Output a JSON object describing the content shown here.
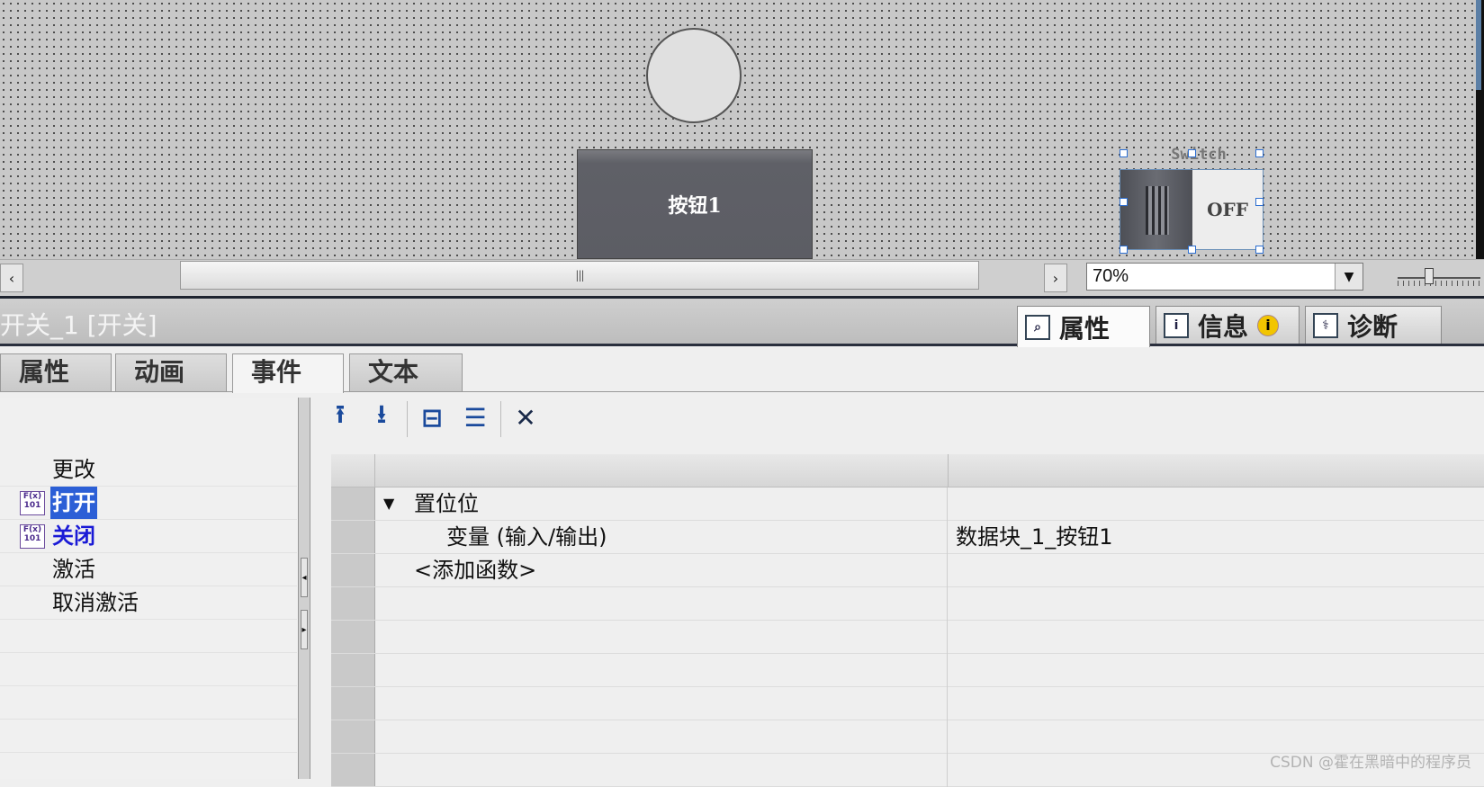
{
  "canvas": {
    "button_label": "按钮1",
    "switch_caption": "Switch",
    "switch_state": "OFF"
  },
  "scrollbar": {
    "left_arrow": "‹",
    "right_arrow": "›",
    "thumb_grip": "|||"
  },
  "zoom": {
    "value": "70%",
    "dropdown_icon": "▼"
  },
  "inspector": {
    "object_title": "开关_1 [开关]",
    "right_tabs": [
      {
        "label": "属性",
        "icon": "magnifier-icon"
      },
      {
        "label": "信息",
        "icon": "info-icon",
        "badge": "i"
      },
      {
        "label": "诊断",
        "icon": "diagnostics-icon"
      }
    ],
    "tabs": [
      "属性",
      "动画",
      "事件",
      "文本"
    ],
    "active_tab": "事件"
  },
  "events": [
    {
      "label": "更改",
      "has_function": false
    },
    {
      "label": "打开",
      "has_function": true,
      "selected": true,
      "fx_icon": "F(x) 101"
    },
    {
      "label": "关闭",
      "has_function": true,
      "fx_icon": "F(x) 101"
    },
    {
      "label": "激活",
      "has_function": false
    },
    {
      "label": "取消激活",
      "has_function": false
    }
  ],
  "splitter": {
    "collapse_left": "◂",
    "collapse_right": "▸"
  },
  "toolbar": {
    "buttons": [
      {
        "name": "move-up",
        "glyph": "⭱"
      },
      {
        "name": "move-down",
        "glyph": "⭳"
      },
      {
        "name": "collapse",
        "glyph": "⊟"
      },
      {
        "name": "expand",
        "glyph": "☰"
      },
      {
        "name": "delete",
        "glyph": "✕"
      }
    ]
  },
  "functions": {
    "group": {
      "label": "置位位",
      "toggle": "▼"
    },
    "param": {
      "name": "变量 (输入/输出)",
      "value": "数据块_1_按钮1"
    },
    "add": "<添加函数>"
  },
  "watermark": "CSDN @霍在黑暗中的程序员",
  "colors": {
    "selection": "#2c5fd6",
    "handle": "#2d6fd1",
    "dark_band": "#1f2430"
  }
}
